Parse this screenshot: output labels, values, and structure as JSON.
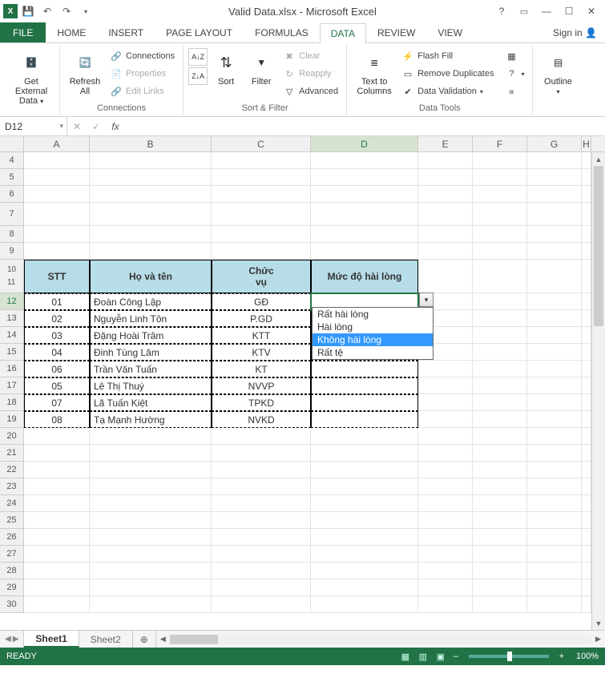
{
  "title": "Valid Data.xlsx - Microsoft Excel",
  "signin": "Sign in",
  "tabs": {
    "file": "FILE",
    "home": "HOME",
    "insert": "INSERT",
    "pagelayout": "PAGE LAYOUT",
    "formulas": "FORMULAS",
    "data": "DATA",
    "review": "REVIEW",
    "view": "VIEW"
  },
  "ribbon": {
    "getexternal": {
      "label": "Get External\nData",
      "drop": "▾"
    },
    "refresh": {
      "label": "Refresh\nAll"
    },
    "connections": {
      "connections": "Connections",
      "properties": "Properties",
      "editlinks": "Edit Links",
      "group": "Connections"
    },
    "sort": {
      "az": "A↓Z",
      "za": "Z↓A",
      "sort": "Sort",
      "filter": "Filter",
      "clear": "Clear",
      "reapply": "Reapply",
      "advanced": "Advanced",
      "group": "Sort & Filter"
    },
    "texttocols": "Text to\nColumns",
    "datatools": {
      "flashfill": "Flash Fill",
      "removedup": "Remove Duplicates",
      "datavalid": "Data Validation",
      "group": "Data Tools"
    },
    "outline": {
      "label": "Outline",
      "group": ""
    }
  },
  "namebox": "D12",
  "columns": [
    "A",
    "B",
    "C",
    "D",
    "E",
    "F",
    "G",
    "H"
  ],
  "row_start": 4,
  "row_end": 30,
  "selected_col": "D",
  "selected_row": 12,
  "table": {
    "headers": {
      "stt": "STT",
      "hoten": "Họ và tên",
      "chucvu_l1": "Chức",
      "chucvu_l2": "vụ",
      "mucdo": "Mức độ hài lòng"
    },
    "rows": [
      {
        "stt": "01",
        "name": "Đoàn Công Lập",
        "role": "GĐ"
      },
      {
        "stt": "02",
        "name": "Nguyễn Linh Tôn",
        "role": "P.GD"
      },
      {
        "stt": "03",
        "name": "Đặng Hoài Trâm",
        "role": "KTT"
      },
      {
        "stt": "04",
        "name": "Đinh Tùng Lâm",
        "role": "KTV"
      },
      {
        "stt": "06",
        "name": "Trần Văn Tuấn",
        "role": "KT"
      },
      {
        "stt": "05",
        "name": "Lê Thị Thuý",
        "role": "NVVP"
      },
      {
        "stt": "07",
        "name": "Lã Tuấn Kiệt",
        "role": "TPKD"
      },
      {
        "stt": "08",
        "name": "Tạ Mạnh Hường",
        "role": "NVKD"
      }
    ]
  },
  "dropdown": {
    "items": [
      "Rất hài lòng",
      "Hài lòng",
      "Không hài lòng",
      "Rất tệ"
    ],
    "highlighted": 2
  },
  "sheets": {
    "s1": "Sheet1",
    "s2": "Sheet2"
  },
  "status": "READY",
  "zoom": "100%"
}
